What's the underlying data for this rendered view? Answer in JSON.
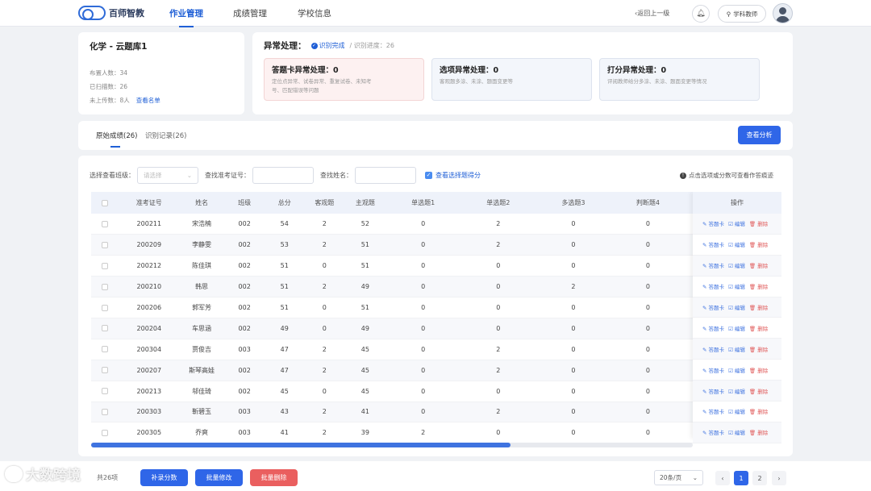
{
  "header": {
    "logo_text": "百师智教",
    "nav": [
      "作业管理",
      "成绩管理",
      "学校信息"
    ],
    "back_label": "返回上一级",
    "role_label": "学科教师"
  },
  "info": {
    "title": "化学 - 云题库1",
    "assigned_label": "布置人数：34",
    "scanned_label": "已扫描数：26",
    "not_uploaded_label": "未上传数：",
    "not_uploaded_value": "8人",
    "view_list": "查看名单"
  },
  "exceptions": {
    "title": "异常处理：",
    "status": "识别完成",
    "progress": "/ 识别进度：26",
    "boxes": [
      {
        "title": "答题卡异常处理：0",
        "desc": "定位点异常、试卷异常、重复试卷、未知考号、匹配错误等问题"
      },
      {
        "title": "选项异常处理：0",
        "desc": "客观题多涂、未涂、题面变更等"
      },
      {
        "title": "打分异常处理：0",
        "desc": "评阅教师给分多涂、未涂、题面变更等情况"
      }
    ]
  },
  "tabs": [
    "原始成绩(26)",
    "识别记录(26)"
  ],
  "analyze_button": "查看分析",
  "filters": {
    "class_label": "选择查看班级：",
    "class_placeholder": "请选择",
    "exam_no_label": "查找准考证号：",
    "name_label": "查找姓名：",
    "show_choice_label": "查看选择题得分",
    "hint": "点击选项或分数可查看作答痕迹"
  },
  "table": {
    "columns": [
      "准考证号",
      "姓名",
      "班级",
      "总分",
      "客观题",
      "主观题",
      "单选题1",
      "单选题2",
      "多选题3",
      "判断题4"
    ],
    "rows": [
      [
        "200211",
        "宋浩楠",
        "002",
        "54",
        "2",
        "52",
        "0",
        "2",
        "0",
        "0"
      ],
      [
        "200209",
        "李静雯",
        "002",
        "53",
        "2",
        "51",
        "0",
        "2",
        "0",
        "0"
      ],
      [
        "200212",
        "陈佳琪",
        "002",
        "51",
        "0",
        "51",
        "0",
        "0",
        "0",
        "0"
      ],
      [
        "200210",
        "韩思",
        "002",
        "51",
        "2",
        "49",
        "0",
        "0",
        "2",
        "0"
      ],
      [
        "200206",
        "郭军芳",
        "002",
        "51",
        "0",
        "51",
        "0",
        "0",
        "0",
        "0"
      ],
      [
        "200204",
        "车思涵",
        "002",
        "49",
        "0",
        "49",
        "0",
        "0",
        "0",
        "0"
      ],
      [
        "200304",
        "贾俊吉",
        "003",
        "47",
        "2",
        "45",
        "0",
        "2",
        "0",
        "0"
      ],
      [
        "200207",
        "斯琴高娃",
        "002",
        "47",
        "2",
        "45",
        "0",
        "2",
        "0",
        "0"
      ],
      [
        "200213",
        "邬佳琦",
        "002",
        "45",
        "0",
        "45",
        "0",
        "0",
        "0",
        "0"
      ],
      [
        "200303",
        "靳碧玉",
        "003",
        "43",
        "2",
        "41",
        "0",
        "2",
        "0",
        "0"
      ],
      [
        "200305",
        "乔爽",
        "003",
        "41",
        "2",
        "39",
        "2",
        "0",
        "0",
        "0"
      ]
    ],
    "ops_header": "操作",
    "ops": [
      "答题卡",
      "编辑",
      "删除"
    ]
  },
  "footer": {
    "total": "共26项",
    "buttons": [
      "补录分数",
      "批量修改",
      "批量删除"
    ],
    "page_size": "20条/页",
    "pages": [
      "1",
      "2"
    ]
  },
  "watermark": "大数跨境"
}
